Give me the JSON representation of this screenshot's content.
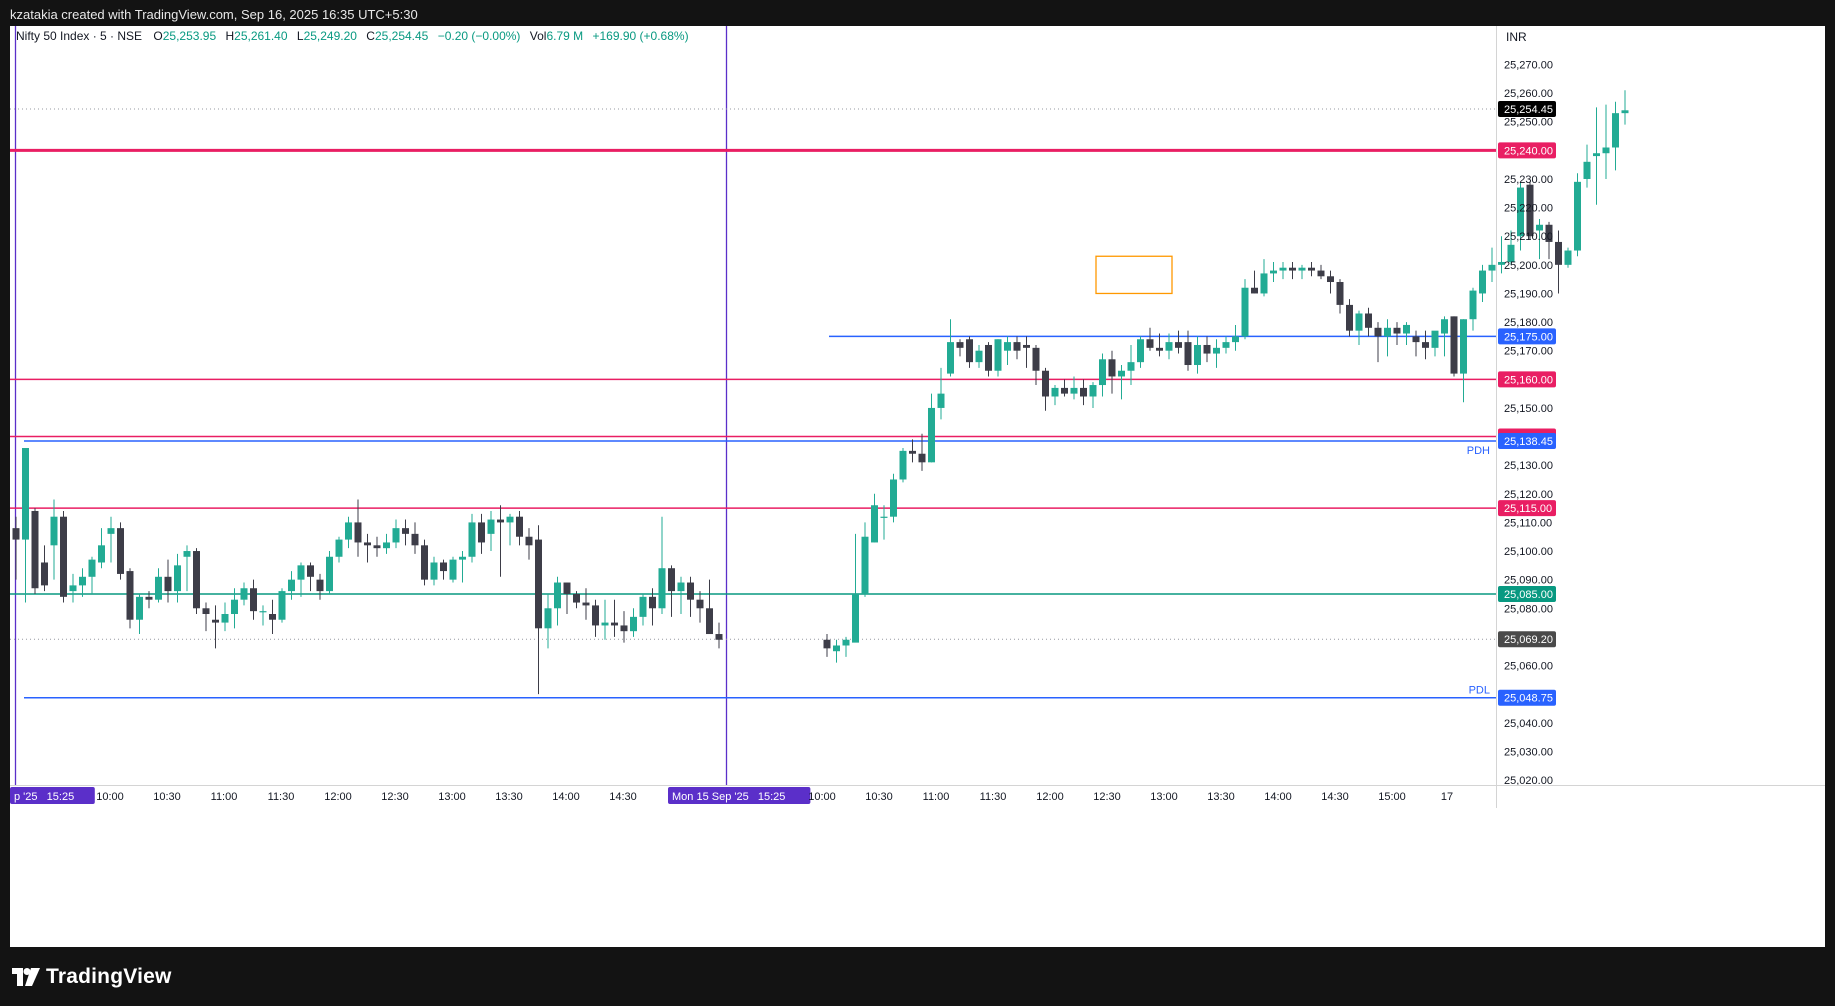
{
  "header": {
    "attribution": "kzatakia created with TradingView.com, Sep 16, 2025 16:35 UTC+5:30"
  },
  "legend": {
    "symbol": "Nifty 50 Index · 5 · NSE",
    "o_label": "O",
    "o_value": "25,253.95",
    "h_label": "H",
    "h_value": "25,261.40",
    "l_label": "L",
    "l_value": "25,249.20",
    "c_label": "C",
    "c_value": "25,254.45",
    "change": "−0.20 (−0.00%)",
    "vol_label": "Vol",
    "vol_value": "6.79 M",
    "day_change": "+169.90 (+0.68%)"
  },
  "currency": "INR",
  "footer": {
    "brand": "TradingView"
  },
  "colors": {
    "up": "#22ab94",
    "down": "#3d3d48",
    "red_level": "#e91e63",
    "blue_level": "#2962ff",
    "green_level": "#089981",
    "session": "#5b2fc9",
    "box": "#ff9800"
  },
  "chart_data": {
    "type": "candlestick",
    "title": "Nifty 50 Index · 5 · NSE",
    "ylim": [
      25015,
      25280
    ],
    "y_ticks": [
      25020,
      25030,
      25040,
      25050,
      25060,
      25070,
      25080,
      25090,
      25100,
      25110,
      25120,
      25130,
      25140,
      25150,
      25160,
      25170,
      25180,
      25190,
      25200,
      25210,
      25220,
      25230,
      25240,
      25250,
      25260,
      25270
    ],
    "x_labels": [
      {
        "text": "p '25  15:25",
        "x": 19
      },
      {
        "text": "10:00",
        "x": 110
      },
      {
        "text": "10:30",
        "x": 167
      },
      {
        "text": "11:00",
        "x": 224
      },
      {
        "text": "11:30",
        "x": 281
      },
      {
        "text": "12:00",
        "x": 338
      },
      {
        "text": "12:30",
        "x": 395
      },
      {
        "text": "13:00",
        "x": 452
      },
      {
        "text": "13:30",
        "x": 509
      },
      {
        "text": "14:00",
        "x": 566
      },
      {
        "text": "14:30",
        "x": 623
      },
      {
        "text": "Mon 15 Sep '25  15:25",
        "x": 726
      },
      {
        "text": "10:00",
        "x": 822
      },
      {
        "text": "10:30",
        "x": 879
      },
      {
        "text": "11:00",
        "x": 936
      },
      {
        "text": "11:30",
        "x": 993
      },
      {
        "text": "12:00",
        "x": 1050
      },
      {
        "text": "12:30",
        "x": 1107
      },
      {
        "text": "13:00",
        "x": 1164
      },
      {
        "text": "13:30",
        "x": 1221
      },
      {
        "text": "14:00",
        "x": 1278
      },
      {
        "text": "14:30",
        "x": 1335
      },
      {
        "text": "15:00",
        "x": 1392
      },
      {
        "text": "17",
        "x": 1447
      }
    ],
    "candles": [
      [
        25108,
        25112,
        25090,
        25104
      ],
      [
        25104,
        25136,
        25082,
        25136
      ],
      [
        25114,
        25115,
        25085,
        25087
      ],
      [
        25096,
        25102,
        25086,
        25088
      ],
      [
        25102,
        25118,
        25090,
        25112
      ],
      [
        25112,
        25114,
        25082,
        25084
      ],
      [
        25086,
        25092,
        25082,
        25088
      ],
      [
        25088,
        25094,
        25084,
        25091
      ],
      [
        25091,
        25098,
        25085,
        25097
      ],
      [
        25096,
        25108,
        25094,
        25102
      ],
      [
        25106,
        25112,
        25096,
        25108
      ],
      [
        25108,
        25110,
        25090,
        25092
      ],
      [
        25093,
        25094,
        25073,
        25076
      ],
      [
        25076,
        25085,
        25071,
        25084
      ],
      [
        25084,
        25086,
        25080,
        25083
      ],
      [
        25083,
        25094,
        25082,
        25091
      ],
      [
        25091,
        25097,
        25082,
        25086
      ],
      [
        25086,
        25099,
        25082,
        25095
      ],
      [
        25098,
        25102,
        25086,
        25100
      ],
      [
        25100,
        25101,
        25078,
        25080
      ],
      [
        25080,
        25082,
        25072,
        25078
      ],
      [
        25076,
        25081,
        25066,
        25075
      ],
      [
        25075,
        25082,
        25072,
        25078
      ],
      [
        25078,
        25087,
        25073,
        25083
      ],
      [
        25083,
        25089,
        25081,
        25087
      ],
      [
        25087,
        25090,
        25076,
        25079
      ],
      [
        25079,
        25081,
        25074,
        25079
      ],
      [
        25078,
        25083,
        25071,
        25076
      ],
      [
        25076,
        25087,
        25075,
        25086
      ],
      [
        25086,
        25093,
        25083,
        25090
      ],
      [
        25090,
        25096,
        25084,
        25095
      ],
      [
        25095,
        25096,
        25086,
        25091
      ],
      [
        25090,
        25092,
        25083,
        25086
      ],
      [
        25086,
        25100,
        25085,
        25098
      ],
      [
        25098,
        25105,
        25096,
        25104
      ],
      [
        25104,
        25112,
        25101,
        25110
      ],
      [
        25110,
        25118,
        25098,
        25103
      ],
      [
        25103,
        25106,
        25096,
        25102
      ],
      [
        25102,
        25105,
        25098,
        25101
      ],
      [
        25101,
        25106,
        25099,
        25103
      ],
      [
        25103,
        25111,
        25101,
        25108
      ],
      [
        25108,
        25111,
        25102,
        25106
      ],
      [
        25106,
        25110,
        25099,
        25102
      ],
      [
        25102,
        25104,
        25088,
        25090
      ],
      [
        25090,
        25098,
        25088,
        25096
      ],
      [
        25096,
        25097,
        25090,
        25093
      ],
      [
        25090,
        25098,
        25089,
        25097
      ],
      [
        25097,
        25100,
        25089,
        25098
      ],
      [
        25098,
        25113,
        25096,
        25110
      ],
      [
        25110,
        25113,
        25099,
        25103
      ],
      [
        25106,
        25114,
        25100,
        25111
      ],
      [
        25111,
        25116,
        25091,
        25110
      ],
      [
        25110,
        25113,
        25102,
        25112
      ],
      [
        25112,
        25114,
        25102,
        25105
      ],
      [
        25105,
        25108,
        25097,
        25102
      ],
      [
        25104,
        25109,
        25050,
        25073
      ],
      [
        25073,
        25085,
        25066,
        25080
      ],
      [
        25080,
        25091,
        25074,
        25089
      ],
      [
        25089,
        25089,
        25078,
        25085
      ],
      [
        25085,
        25086,
        25080,
        25082
      ],
      [
        25082,
        25087,
        25076,
        25081
      ],
      [
        25081,
        25083,
        25070,
        25074
      ],
      [
        25074,
        25083,
        25069,
        25075
      ],
      [
        25075,
        25083,
        25070,
        25074
      ],
      [
        25074,
        25079,
        25068,
        25072
      ],
      [
        25072,
        25080,
        25070,
        25077
      ],
      [
        25077,
        25085,
        25074,
        25084
      ],
      [
        25084,
        25087,
        25074,
        25080
      ],
      [
        25080,
        25112,
        25078,
        25094
      ],
      [
        25094,
        25095,
        25077,
        25086
      ],
      [
        25086,
        25091,
        25078,
        25089
      ],
      [
        25089,
        25091,
        25077,
        25083
      ],
      [
        25083,
        25086,
        25075,
        25080
      ],
      [
        25080,
        25090,
        25072,
        25071
      ],
      [
        25071,
        25075,
        25066,
        25069
      ],
      [
        25069,
        25071,
        25063,
        25066
      ],
      [
        25065,
        25069,
        25061,
        25067
      ],
      [
        25067,
        25070,
        25063,
        25069
      ],
      [
        25068,
        25106,
        25073,
        25085
      ],
      [
        25085,
        25110,
        25084,
        25105
      ],
      [
        25103,
        25120,
        25103,
        25116
      ],
      [
        25112,
        25116,
        25104,
        25112
      ],
      [
        25112,
        25127,
        25110,
        25125
      ],
      [
        25125,
        25136,
        25124,
        25135
      ],
      [
        25135,
        25139,
        25131,
        25134
      ],
      [
        25134,
        25141,
        25128,
        25131
      ],
      [
        25131,
        25155,
        25131,
        25150
      ],
      [
        25150,
        25164,
        25146,
        25155
      ],
      [
        25162,
        25181,
        25161,
        25173
      ],
      [
        25173,
        25174,
        25168,
        25171
      ],
      [
        25174,
        25175,
        25164,
        25166
      ],
      [
        25166,
        25172,
        25164,
        25170
      ],
      [
        25172,
        25173,
        25161,
        25163
      ],
      [
        25163,
        25174,
        25161,
        25174
      ],
      [
        25170,
        25175,
        25165,
        25173
      ],
      [
        25173,
        25175,
        25167,
        25170
      ],
      [
        25172,
        25175,
        25164,
        25171
      ],
      [
        25171,
        25172,
        25158,
        25163
      ],
      [
        25163,
        25164,
        25149,
        25154
      ],
      [
        25154,
        25158,
        25151,
        25157
      ],
      [
        25157,
        25160,
        25154,
        25155
      ],
      [
        25155,
        25161,
        25153,
        25157
      ],
      [
        25157,
        25160,
        25151,
        25154
      ],
      [
        25154,
        25159,
        25150,
        25158
      ],
      [
        25158,
        25169,
        25154,
        25167
      ],
      [
        25167,
        25170,
        25155,
        25161
      ],
      [
        25161,
        25165,
        25153,
        25163
      ],
      [
        25163,
        25172,
        25158,
        25166
      ],
      [
        25166,
        25175,
        25164,
        25174
      ],
      [
        25174,
        25178,
        25170,
        25171
      ],
      [
        25171,
        25176,
        25168,
        25170
      ],
      [
        25170,
        25176,
        25167,
        25173
      ],
      [
        25173,
        25177,
        25169,
        25171
      ],
      [
        25173,
        25177,
        25163,
        25165
      ],
      [
        25165,
        25175,
        25162,
        25172
      ],
      [
        25172,
        25175,
        25166,
        25169
      ],
      [
        25169,
        25174,
        25164,
        25171
      ],
      [
        25171,
        25175,
        25169,
        25173
      ],
      [
        25173,
        25179,
        25170,
        25175
      ],
      [
        25175,
        25195,
        25174,
        25192
      ],
      [
        25192,
        25198,
        25190,
        25190
      ],
      [
        25190,
        25202,
        25189,
        25197
      ],
      [
        25197,
        25201,
        25194,
        25198
      ],
      [
        25198,
        25201,
        25195,
        25199
      ],
      [
        25199,
        25201,
        25195,
        25198
      ],
      [
        25198,
        25200,
        25195,
        25199
      ],
      [
        25199,
        25201,
        25196,
        25198
      ],
      [
        25198,
        25200,
        25195,
        25196
      ],
      [
        25196,
        25198,
        25190,
        25194
      ],
      [
        25194,
        25195,
        25183,
        25186
      ],
      [
        25186,
        25188,
        25175,
        25177
      ],
      [
        25177,
        25184,
        25172,
        25183
      ],
      [
        25183,
        25185,
        25175,
        25178
      ],
      [
        25178,
        25180,
        25166,
        25175
      ],
      [
        25175,
        25181,
        25168,
        25178
      ],
      [
        25178,
        25180,
        25172,
        25176
      ],
      [
        25176,
        25180,
        25172,
        25179
      ],
      [
        25175,
        25177,
        25168,
        25173
      ],
      [
        25173,
        25177,
        25167,
        25171
      ],
      [
        25171,
        25176,
        25168,
        25177
      ],
      [
        25176,
        25182,
        25168,
        25181
      ],
      [
        25182,
        25182,
        25161,
        25162
      ],
      [
        25162,
        25181,
        25152,
        25181
      ],
      [
        25181,
        25192,
        25177,
        25191
      ],
      [
        25190,
        25200,
        25187,
        25198
      ],
      [
        25198,
        25206,
        25194,
        25200
      ],
      [
        25200,
        25210,
        25197,
        25201
      ],
      [
        25201,
        25212,
        25200,
        25207
      ],
      [
        25210,
        25229,
        25205,
        25227
      ],
      [
        25228,
        25229,
        25209,
        25210
      ],
      [
        25212,
        25216,
        25202,
        25214
      ],
      [
        25214,
        25215,
        25202,
        25208
      ],
      [
        25208,
        25212,
        25190,
        25200
      ],
      [
        25200,
        25206,
        25199,
        25205
      ],
      [
        25205,
        25232,
        25203,
        25229
      ],
      [
        25230,
        25242,
        25227,
        25236
      ],
      [
        25238,
        25255,
        25221,
        25239
      ],
      [
        25239,
        25256,
        25230,
        25241
      ],
      [
        25241,
        25257,
        25233,
        25253
      ],
      [
        25253,
        25261,
        25249,
        25254
      ]
    ],
    "levels": [
      {
        "price": 25240.0,
        "label": "25,240.00",
        "kind": "red",
        "width": 3
      },
      {
        "price": 25175.0,
        "label": "25,175.00",
        "kind": "blue",
        "start": 829
      },
      {
        "price": 25160.0,
        "label": "25,160.00",
        "kind": "red"
      },
      {
        "price": 25140.0,
        "label": "25,140.00",
        "kind": "red"
      },
      {
        "price": 25138.45,
        "label": "25,138.45",
        "kind": "blue",
        "name": "PDH",
        "start": 24
      },
      {
        "price": 25115.0,
        "label": "25,115.00",
        "kind": "red"
      },
      {
        "price": 25085.0,
        "label": "25,085.00",
        "kind": "green"
      },
      {
        "price": 25048.75,
        "label": "25,048.75",
        "kind": "blue",
        "name": "PDL",
        "start": 24
      }
    ],
    "dotted_levels": [
      {
        "price": 25254.45,
        "label": "25,254.45",
        "kind": "last"
      },
      {
        "price": 25069.2,
        "label": "25,069.20",
        "kind": "gray"
      }
    ],
    "session_breaks": [
      15,
      726
    ],
    "box": {
      "from_price": 25190,
      "to_price": 25203,
      "from_x": 1096,
      "to_x": 1172
    }
  }
}
